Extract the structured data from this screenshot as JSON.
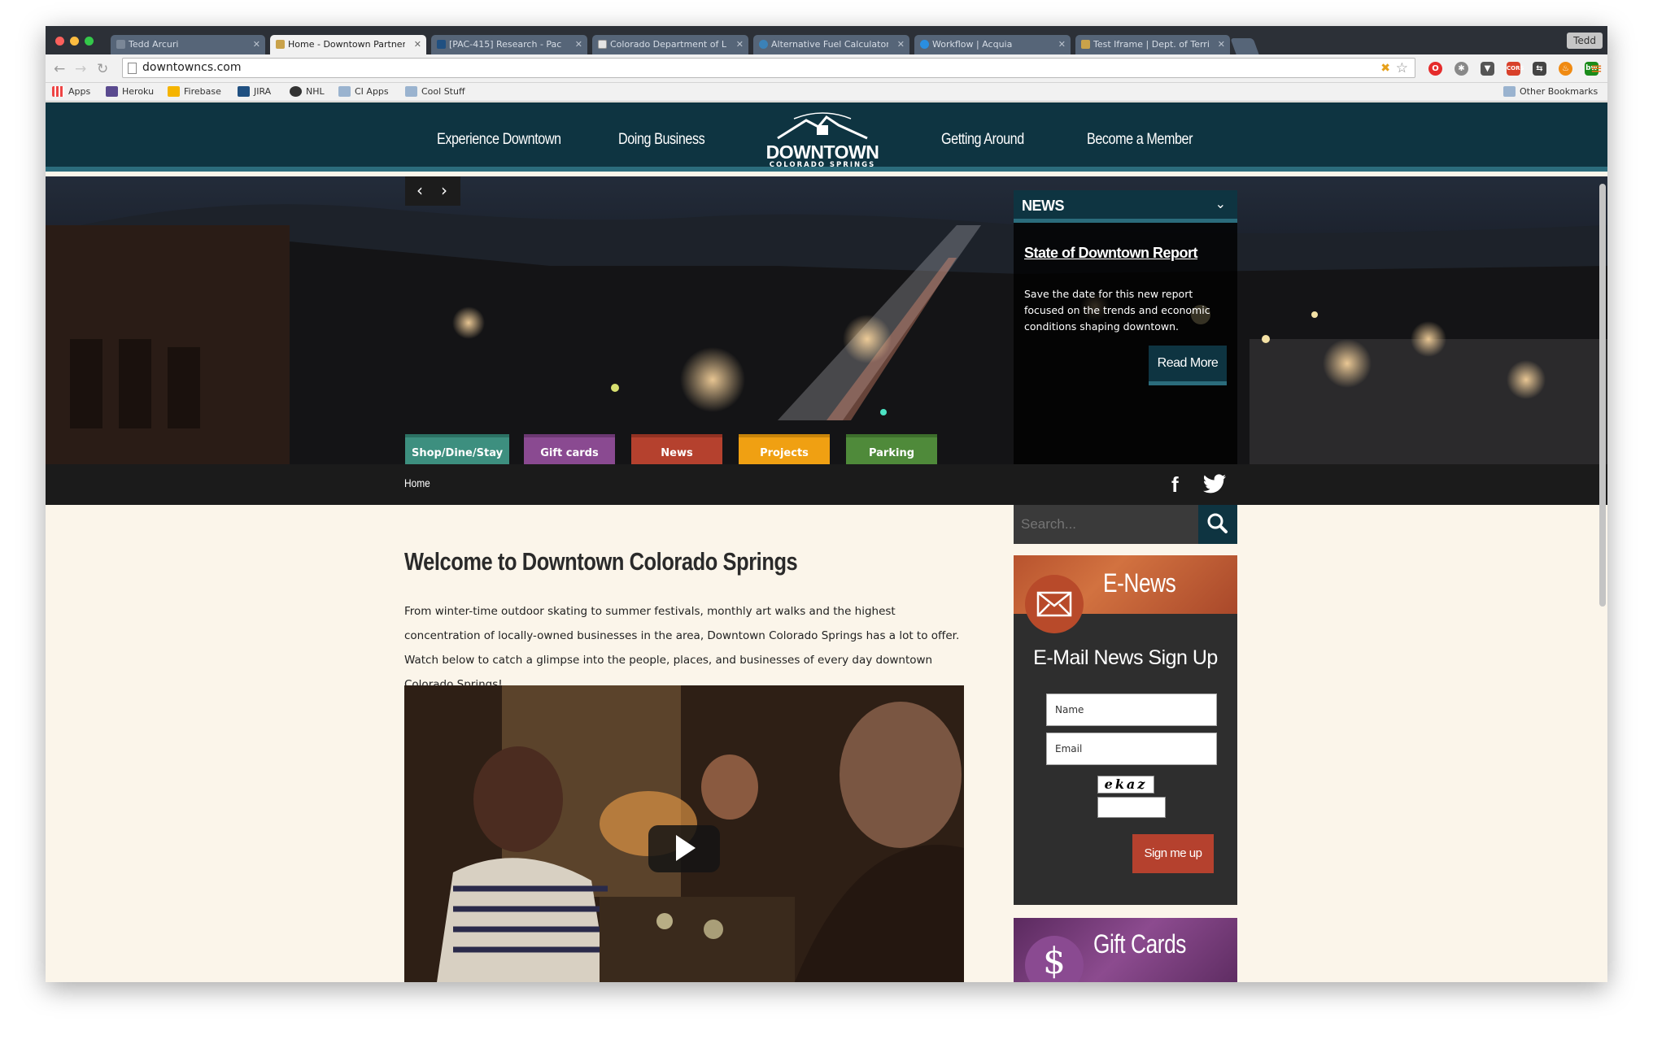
{
  "browser": {
    "profile_name": "Tedd",
    "url": "downtowncs.com",
    "tabs": [
      {
        "title": "Tedd Arcuri",
        "active": false
      },
      {
        "title": "Home - Downtown Partner",
        "active": true
      },
      {
        "title": "[PAC-415] Research - Pac",
        "active": false
      },
      {
        "title": "Colorado Department of L",
        "active": false
      },
      {
        "title": "Alternative Fuel Calculator",
        "active": false
      },
      {
        "title": "Workflow | Acquia",
        "active": false
      },
      {
        "title": "Test Iframe | Dept. of Terri",
        "active": false
      }
    ],
    "bookmarks": [
      "Apps",
      "Heroku",
      "Firebase",
      "JIRA",
      "NHL",
      "CI Apps",
      "Cool Stuff"
    ],
    "other_bookmarks": "Other Bookmarks"
  },
  "site": {
    "nav": [
      "Experience Downtown",
      "Doing Business",
      "Getting Around",
      "Become a Member"
    ],
    "logo": {
      "main": "DOWNTOWN",
      "sub": "COLORADO SPRINGS"
    },
    "news_panel": {
      "header": "NEWS",
      "headline": "State of Downtown Report",
      "body": "Save the date for this new report focused on the trends and economic conditions shaping downtown.",
      "cta": "Read More"
    },
    "categories": [
      {
        "label": "Shop/Dine/Stay",
        "color": "#3d8f7f"
      },
      {
        "label": "Gift cards",
        "color": "#8a4a91"
      },
      {
        "label": "News",
        "color": "#b5412e"
      },
      {
        "label": "Projects",
        "color": "#f0a012"
      },
      {
        "label": "Parking",
        "color": "#4f8a3a"
      }
    ],
    "breadcrumb": "Home",
    "search_placeholder": "Search...",
    "welcome_title": "Welcome to Downtown Colorado Springs",
    "intro": "From winter-time outdoor skating to summer festivals, monthly art walks and the highest concentration of locally-owned businesses in the area, Downtown Colorado Springs has a lot to offer. Watch below to catch a glimpse into the people, places, and businesses of every day downtown Colorado Springs!",
    "enews": {
      "title": "E-News",
      "subtitle": "E-Mail News Sign Up",
      "name_placeholder": "Name",
      "email_placeholder": "Email",
      "captcha": "ekaz",
      "submit": "Sign me up"
    },
    "giftcards": {
      "title": "Gift Cards"
    }
  }
}
